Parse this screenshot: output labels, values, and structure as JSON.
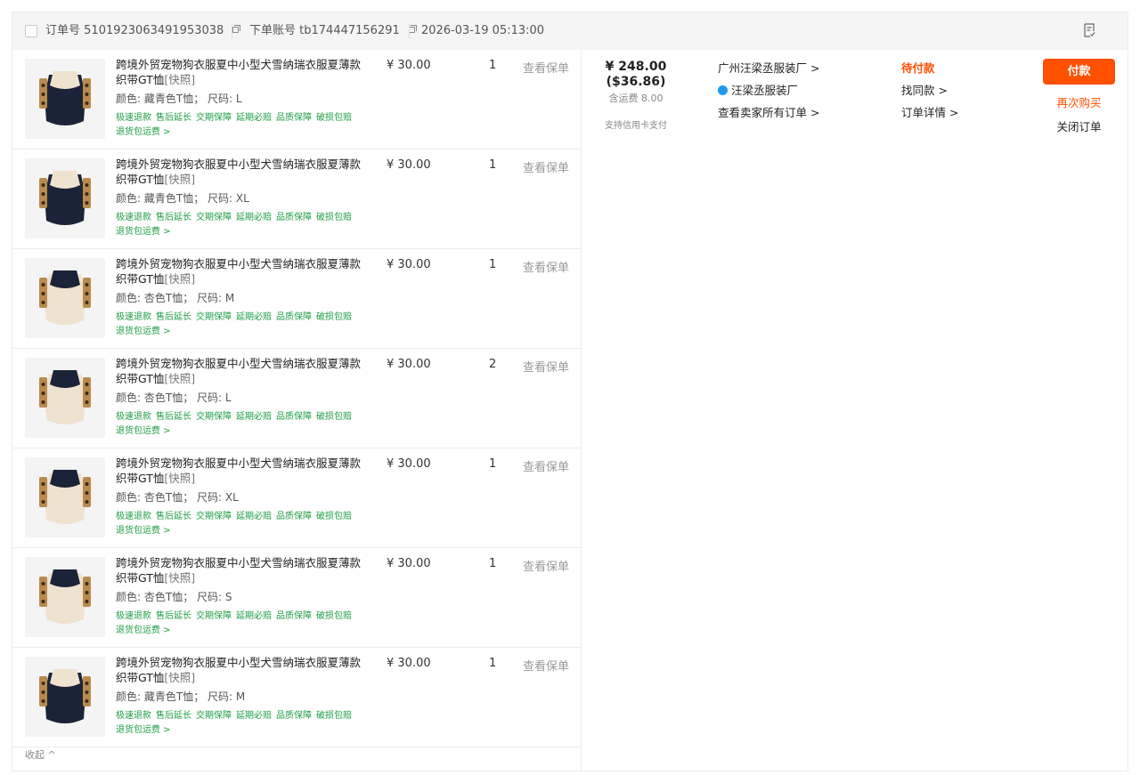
{
  "header": {
    "order_no_label": "订单号",
    "order_no": "5101923063491953038",
    "account_label": "下单账号",
    "account": "tb174447156291",
    "datetime": "2026-03-19 05:13:00"
  },
  "items": [
    {
      "title": "跨境外贸宠物狗衣服夏中小型犬雪纳瑞衣服夏薄款织带GT恤",
      "snapshot": "[快照]",
      "spec": "颜色: 藏青色T恤； 尺码: L",
      "price": "¥ 30.00",
      "qty": "1",
      "policy": "查看保单",
      "image": "navy-shirt-icon"
    },
    {
      "title": "跨境外贸宠物狗衣服夏中小型犬雪纳瑞衣服夏薄款织带GT恤",
      "snapshot": "[快照]",
      "spec": "颜色: 藏青色T恤； 尺码: XL",
      "price": "¥ 30.00",
      "qty": "1",
      "policy": "查看保单",
      "image": "navy-shirt-icon"
    },
    {
      "title": "跨境外贸宠物狗衣服夏中小型犬雪纳瑞衣服夏薄款织带GT恤",
      "snapshot": "[快照]",
      "spec": "颜色: 杏色T恤； 尺码: M",
      "price": "¥ 30.00",
      "qty": "1",
      "policy": "查看保单",
      "image": "apricot-shirt-icon"
    },
    {
      "title": "跨境外贸宠物狗衣服夏中小型犬雪纳瑞衣服夏薄款织带GT恤",
      "snapshot": "[快照]",
      "spec": "颜色: 杏色T恤； 尺码: L",
      "price": "¥ 30.00",
      "qty": "2",
      "policy": "查看保单",
      "image": "apricot-shirt-icon"
    },
    {
      "title": "跨境外贸宠物狗衣服夏中小型犬雪纳瑞衣服夏薄款织带GT恤",
      "snapshot": "[快照]",
      "spec": "颜色: 杏色T恤； 尺码: XL",
      "price": "¥ 30.00",
      "qty": "1",
      "policy": "查看保单",
      "image": "apricot-shirt-icon"
    },
    {
      "title": "跨境外贸宠物狗衣服夏中小型犬雪纳瑞衣服夏薄款织带GT恤",
      "snapshot": "[快照]",
      "spec": "颜色: 杏色T恤； 尺码: S",
      "price": "¥ 30.00",
      "qty": "1",
      "policy": "查看保单",
      "image": "apricot-shirt-icon"
    },
    {
      "title": "跨境外贸宠物狗衣服夏中小型犬雪纳瑞衣服夏薄款织带GT恤",
      "snapshot": "[快照]",
      "spec": "颜色: 藏青色T恤； 尺码: M",
      "price": "¥ 30.00",
      "qty": "1",
      "policy": "查看保单",
      "image": "navy-shirt-icon"
    }
  ],
  "services": [
    "极速退款",
    "售后延长",
    "交期保障",
    "延期必赔",
    "品质保障",
    "破损包赔",
    "退货包运费 >"
  ],
  "collapse_label": "收起 ^",
  "total": {
    "cny": "¥ 248.00",
    "usd": "($36.86)",
    "shipping": "含运费 8.00",
    "credit": "支持信用卡支付"
  },
  "seller": {
    "shop": "广州汪梁丞服装厂 >",
    "wangwang": "汪梁丞服装厂",
    "all_orders": "查看卖家所有订单 >"
  },
  "status": {
    "label": "待付款",
    "find_same": "找同款 >",
    "details": "订单详情 >"
  },
  "actions": {
    "pay": "付款",
    "rebuy": "再次购买",
    "close": "关闭订单"
  },
  "colors": {
    "accent": "#ff5000",
    "service_green": "#1e9e45",
    "navy": "#1b2338",
    "apricot": "#efe2cf",
    "stripe": "#b98a4c"
  }
}
